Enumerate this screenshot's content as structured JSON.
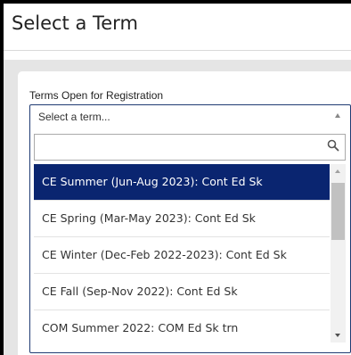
{
  "page": {
    "title": "Select a Term"
  },
  "term_field": {
    "label": "Terms Open for Registration",
    "selected_text": "Select a term...",
    "search_value": "",
    "options": [
      {
        "label": "CE Summer (Jun-Aug 2023): Cont Ed Sk",
        "highlighted": true
      },
      {
        "label": "CE Spring (Mar-May 2023): Cont Ed Sk",
        "highlighted": false
      },
      {
        "label": "CE Winter (Dec-Feb 2022-2023): Cont Ed Sk",
        "highlighted": false
      },
      {
        "label": "CE Fall (Sep-Nov 2022): Cont Ed Sk",
        "highlighted": false
      },
      {
        "label": "COM Summer 2022: COM Ed Sk trn",
        "highlighted": false
      }
    ]
  },
  "colors": {
    "highlight": "#0a2570",
    "select_border": "#1f3b73",
    "band": "#e5e5e5"
  },
  "icons": {
    "dropdown": "triangle-up-icon",
    "search": "magnifier-icon",
    "scroll_up": "scroll-up-arrow-icon",
    "scroll_down": "scroll-down-arrow-icon"
  }
}
